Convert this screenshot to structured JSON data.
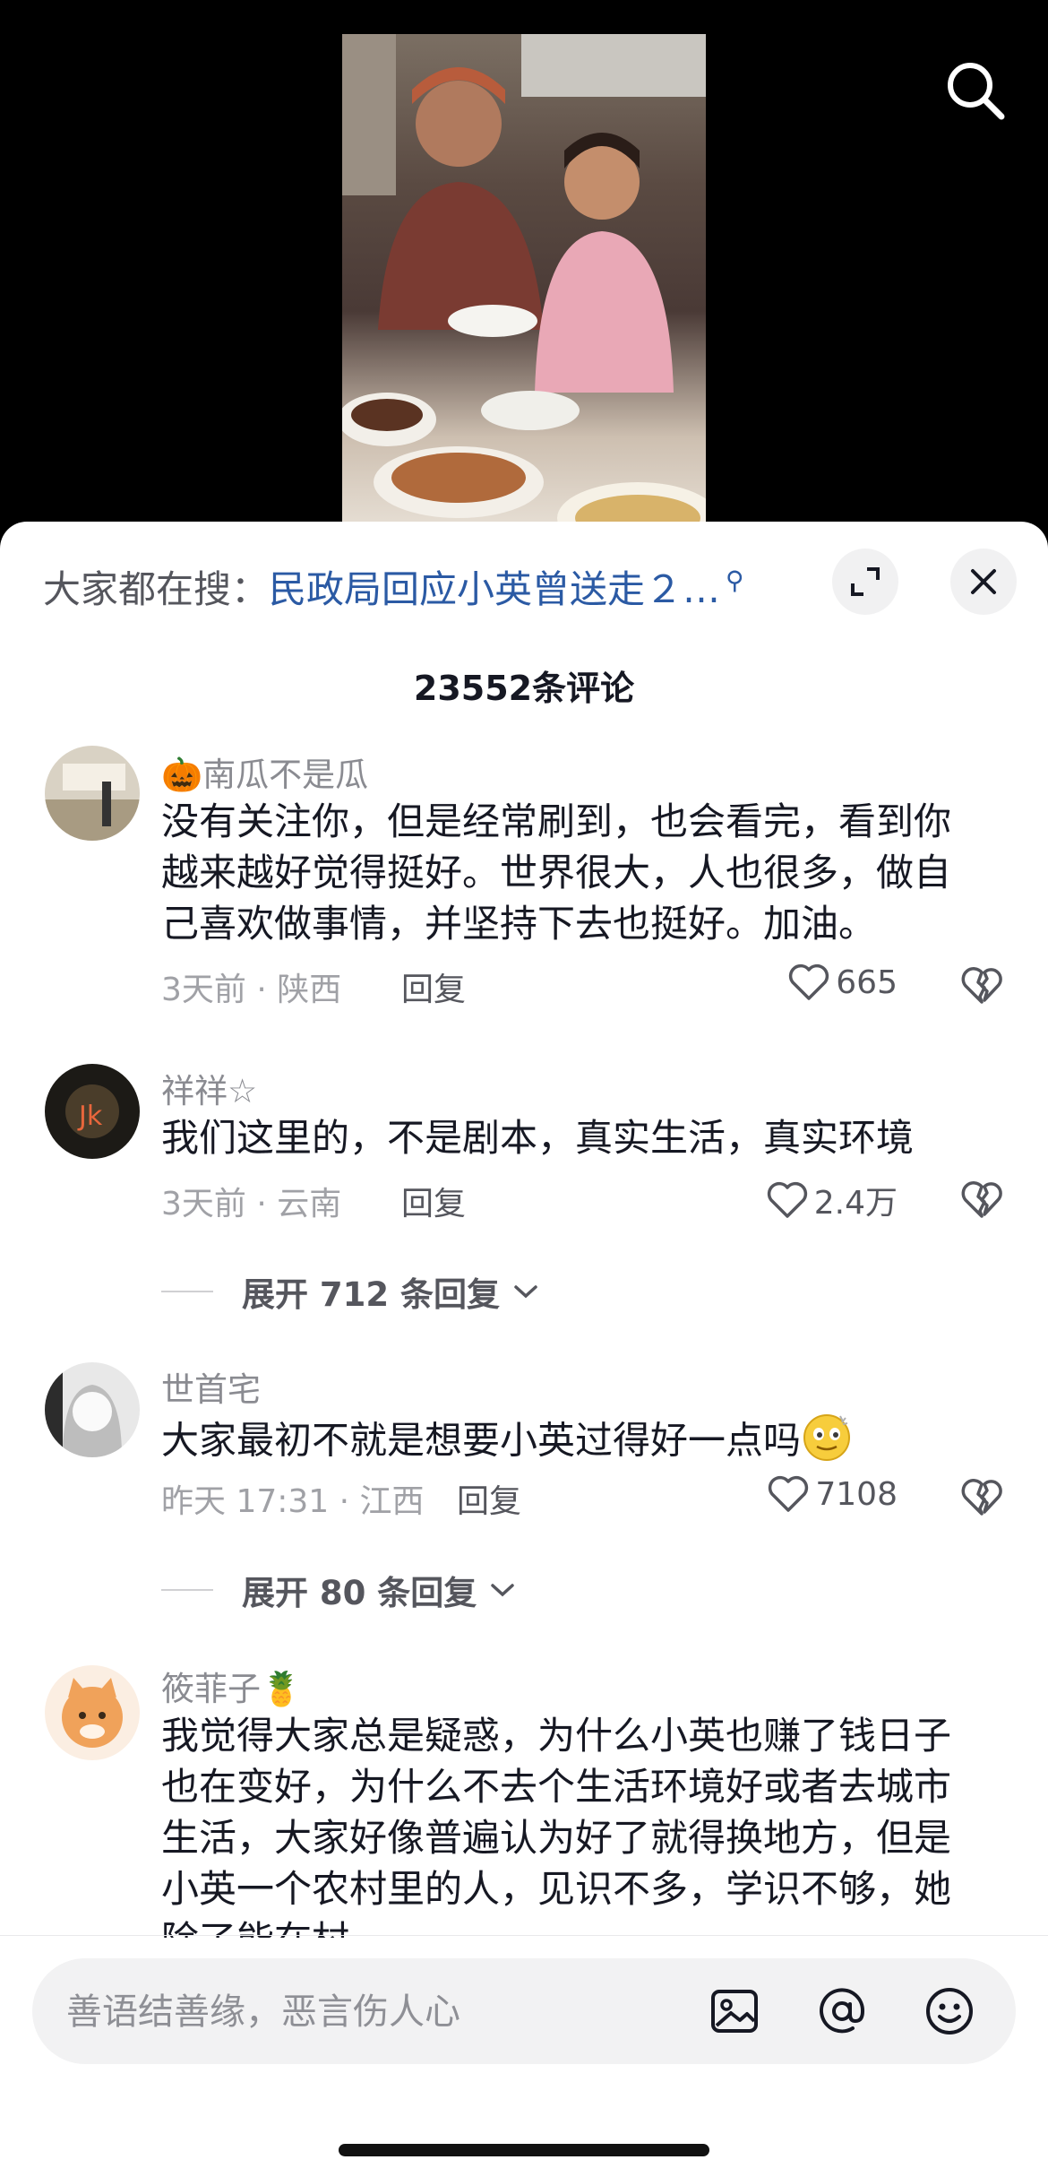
{
  "trending": {
    "prefix": "大家都在搜：",
    "query": "民政局回应小英曾送走２…"
  },
  "comments_header": {
    "title": "23552条评论"
  },
  "comments": [
    {
      "user": "南瓜不是瓜",
      "user_emoji": "🎃",
      "text": "没有关注你，但是经常刷到，也会看完，看到你越来越好觉得挺好。世界很大，人也很多，做自己喜欢做事情，并坚持下去也挺好。加油。",
      "meta": "3天前 · 陕西",
      "reply_label": "回复",
      "likes": "665"
    },
    {
      "user": "祥祥☆",
      "text": "我们这里的，不是剧本，真实生活，真实环境",
      "meta": "3天前 · 云南",
      "reply_label": "回复",
      "likes": "2.4万",
      "expand_label": "展开 712 条回复"
    },
    {
      "user": "世首宅",
      "text": "大家最初不就是想要小英过得好一点吗",
      "meta": "昨天 17:31 · 江西",
      "reply_label": "回复",
      "likes": "7108",
      "expand_label": "展开 80 条回复"
    },
    {
      "user": "筱菲子",
      "user_emoji": "🍍",
      "text": "我觉得大家总是疑惑，为什么小英也赚了钱日子也在变好，为什么不去个生活环境好或者去城市生活，大家好像普遍认为好了就得换地方，但是小英一个农村里的人，见识不多，学识不够，她除了能在村"
    }
  ],
  "input": {
    "placeholder": "善语结善缘，恶言伤人心"
  },
  "icons": {
    "search": "search-icon",
    "expand": "expand-icon",
    "close": "close-icon",
    "like": "heart-icon",
    "dislike": "broken-heart-icon",
    "image": "image-icon",
    "mention": "at-icon",
    "emoji": "smiley-icon"
  },
  "colors": {
    "link": "#2b5aa4",
    "background": "#ffffff",
    "video_bg": "#000000"
  }
}
